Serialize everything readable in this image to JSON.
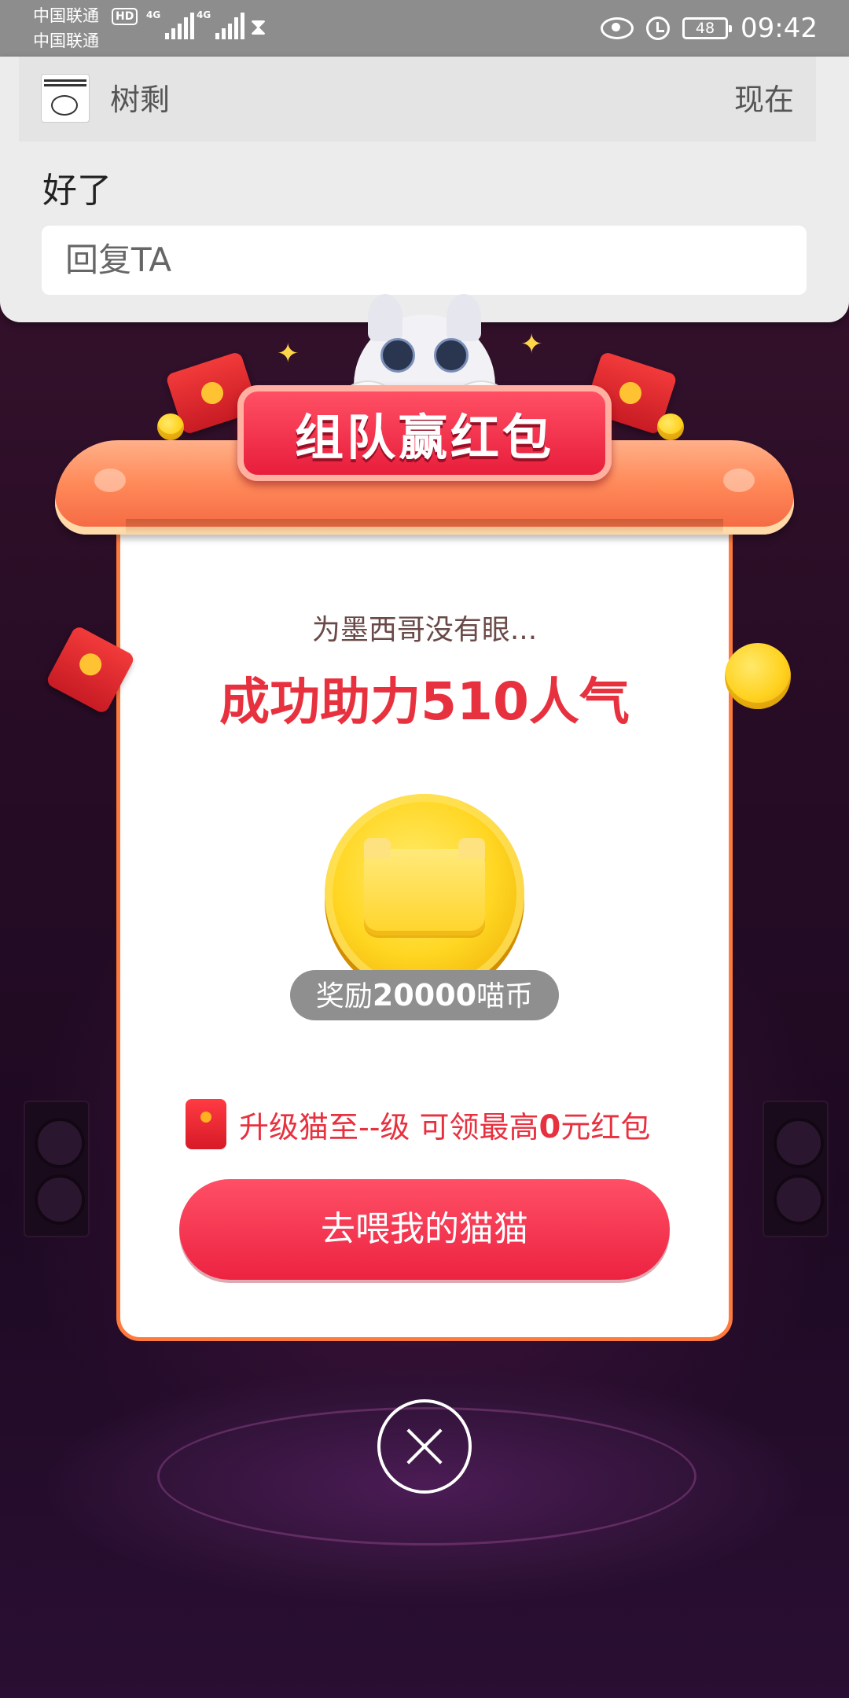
{
  "status_bar": {
    "carrier_1": "中国联通",
    "carrier_2": "中国联通",
    "hd": "HD",
    "network_1": "4G",
    "network_2": "4G",
    "battery": "48",
    "time": "09:42"
  },
  "notification": {
    "app_name": "树剩",
    "time": "现在",
    "message": "好了",
    "reply_placeholder": "回复TA"
  },
  "dialog": {
    "banner_title": "组队赢红包",
    "helper_name": "为墨西哥没有眼...",
    "helper_prefix": "成功助力",
    "helper_count": "510",
    "helper_suffix": "人气",
    "reward_prefix": "奖励",
    "reward_amount": "20000",
    "reward_suffix": "喵币",
    "upgrade_prefix": "升级猫至--级 可领最高",
    "upgrade_amount": "0",
    "upgrade_suffix": "元红包",
    "cta_label": "去喂我的猫猫"
  },
  "icons": {
    "close": "close-icon",
    "red_envelope": "red-envelope-icon",
    "coin": "coin-icon",
    "eye": "eye-icon",
    "alarm": "alarm-icon"
  },
  "colors": {
    "accent_red": "#e8313f",
    "card_border": "#ff7a3d",
    "status_bar": "#8d8d8d"
  }
}
